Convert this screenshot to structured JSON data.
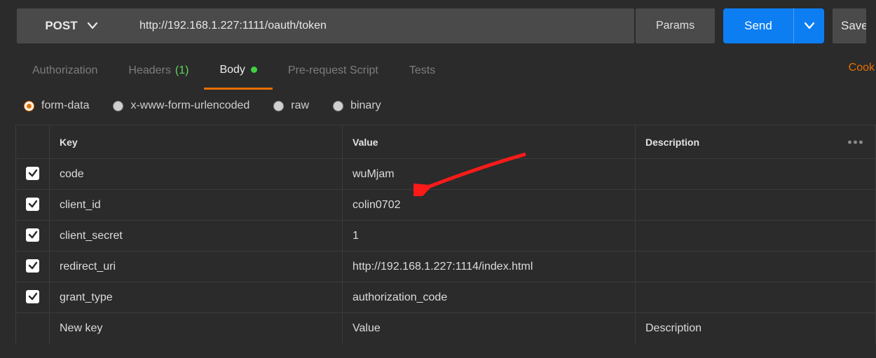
{
  "request": {
    "method": "POST",
    "url": "http://192.168.1.227:1111/oauth/token",
    "params_btn": "Params",
    "send_btn": "Send",
    "save_btn": "Save"
  },
  "tabs": {
    "authorization": "Authorization",
    "headers": "Headers",
    "headers_count": "(1)",
    "body": "Body",
    "prerequest": "Pre-request Script",
    "tests": "Tests",
    "cookies": "Cook"
  },
  "body_types": {
    "form_data": "form-data",
    "urlencoded": "x-www-form-urlencoded",
    "raw": "raw",
    "binary": "binary"
  },
  "table": {
    "head_key": "Key",
    "head_value": "Value",
    "head_desc": "Description",
    "rows": [
      {
        "key": "code",
        "value": "wuMjam",
        "desc": ""
      },
      {
        "key": "client_id",
        "value": "colin0702",
        "desc": ""
      },
      {
        "key": "client_secret",
        "value": "1",
        "desc": ""
      },
      {
        "key": "redirect_uri",
        "value": "http://192.168.1.227:1114/index.html",
        "desc": ""
      },
      {
        "key": "grant_type",
        "value": "authorization_code",
        "desc": ""
      }
    ],
    "placeholder_key": "New key",
    "placeholder_value": "Value",
    "placeholder_desc": "Description"
  }
}
